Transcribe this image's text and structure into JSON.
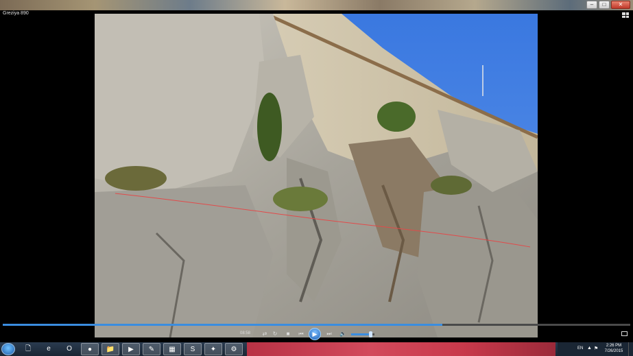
{
  "window": {
    "title": "Greziya 890",
    "minimize_label": "–",
    "maximize_label": "□",
    "close_label": "✕"
  },
  "player": {
    "elapsed_time": "08:58",
    "progress_fraction": 0.7,
    "volume_fraction": 0.85,
    "icons": {
      "stop": "stop-icon",
      "repeat": "repeat-icon",
      "previous": "previous-icon",
      "play": "play-icon",
      "next": "next-icon",
      "mute": "volume-icon"
    },
    "glyphs": {
      "shuffle": "⇄",
      "repeat": "↻",
      "stop": "■",
      "previous": "⏮",
      "play": "▶",
      "next": "⏭",
      "mute": "🔈"
    }
  },
  "taskbar": {
    "language": "EN",
    "tray_up_glyph": "▲",
    "clock_time": "2:26 PM",
    "clock_date": "7/26/2015",
    "apps": [
      {
        "name": "file-icon",
        "glyph": "🗋"
      },
      {
        "name": "internet-explorer-icon",
        "glyph": "e"
      },
      {
        "name": "opera-icon",
        "glyph": "O"
      },
      {
        "name": "chrome-icon",
        "glyph": "●"
      },
      {
        "name": "folder-icon",
        "glyph": "📁"
      },
      {
        "name": "media-player-icon",
        "glyph": "▶"
      },
      {
        "name": "paint-icon",
        "glyph": "✎"
      },
      {
        "name": "calculator-icon",
        "glyph": "▦"
      },
      {
        "name": "skype-icon",
        "glyph": "S"
      },
      {
        "name": "windows-update-icon",
        "glyph": "✦"
      },
      {
        "name": "tool-icon",
        "glyph": "⚙"
      }
    ]
  },
  "colors": {
    "accent": "#3a8de0",
    "sky": "#3f7fe0"
  }
}
